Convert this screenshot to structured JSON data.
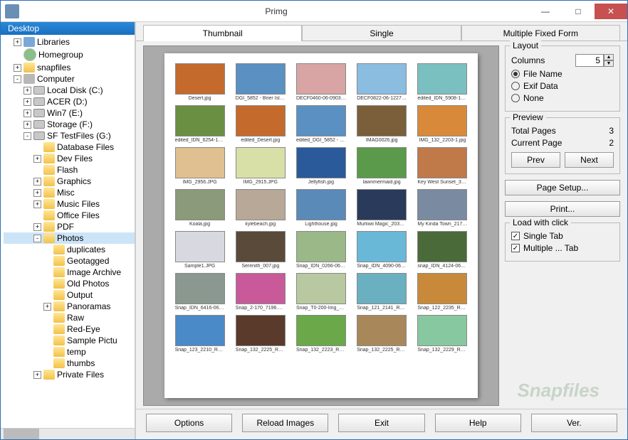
{
  "window": {
    "title": "Primg"
  },
  "tree": {
    "header": "Desktop",
    "nodes": [
      {
        "label": "Libraries",
        "icon": "lib",
        "exp": "+",
        "indent": 1
      },
      {
        "label": "Homegroup",
        "icon": "group",
        "exp": "",
        "indent": 1
      },
      {
        "label": "snapfiles",
        "icon": "folder",
        "exp": "+",
        "indent": 1
      },
      {
        "label": "Computer",
        "icon": "comp",
        "exp": "-",
        "indent": 1
      },
      {
        "label": "Local Disk (C:)",
        "icon": "disk",
        "exp": "+",
        "indent": 2
      },
      {
        "label": "ACER (D:)",
        "icon": "disk",
        "exp": "+",
        "indent": 2
      },
      {
        "label": "Win7 (E:)",
        "icon": "disk",
        "exp": "+",
        "indent": 2
      },
      {
        "label": "Storage (F:)",
        "icon": "disk",
        "exp": "+",
        "indent": 2
      },
      {
        "label": "SF TestFiles (G:)",
        "icon": "disk",
        "exp": "-",
        "indent": 2
      },
      {
        "label": "Database Files",
        "icon": "folder",
        "exp": "",
        "indent": 3
      },
      {
        "label": "Dev Files",
        "icon": "folder",
        "exp": "+",
        "indent": 3
      },
      {
        "label": "Flash",
        "icon": "folder",
        "exp": "",
        "indent": 3
      },
      {
        "label": "Graphics",
        "icon": "folder",
        "exp": "+",
        "indent": 3
      },
      {
        "label": "Misc",
        "icon": "folder",
        "exp": "+",
        "indent": 3
      },
      {
        "label": "Music Files",
        "icon": "folder",
        "exp": "+",
        "indent": 3
      },
      {
        "label": "Office Files",
        "icon": "folder",
        "exp": "",
        "indent": 3
      },
      {
        "label": "PDF",
        "icon": "folder",
        "exp": "+",
        "indent": 3
      },
      {
        "label": "Photos",
        "icon": "folder",
        "exp": "-",
        "indent": 3,
        "selected": true
      },
      {
        "label": "duplicates",
        "icon": "folder",
        "exp": "",
        "indent": 4
      },
      {
        "label": "Geotagged",
        "icon": "folder",
        "exp": "",
        "indent": 4
      },
      {
        "label": "Image Archive",
        "icon": "folder",
        "exp": "",
        "indent": 4
      },
      {
        "label": "Old Photos",
        "icon": "folder",
        "exp": "",
        "indent": 4
      },
      {
        "label": "Output",
        "icon": "folder",
        "exp": "",
        "indent": 4
      },
      {
        "label": "Panoramas",
        "icon": "folder",
        "exp": "+",
        "indent": 4
      },
      {
        "label": "Raw",
        "icon": "folder",
        "exp": "",
        "indent": 4
      },
      {
        "label": "Red-Eye",
        "icon": "folder",
        "exp": "",
        "indent": 4
      },
      {
        "label": "Sample Pictu",
        "icon": "folder",
        "exp": "",
        "indent": 4
      },
      {
        "label": "temp",
        "icon": "folder",
        "exp": "",
        "indent": 4
      },
      {
        "label": "thumbs",
        "icon": "folder",
        "exp": "",
        "indent": 4
      },
      {
        "label": "Private Files",
        "icon": "folder",
        "exp": "+",
        "indent": 3
      }
    ]
  },
  "tabs": [
    "Thumbnail",
    "Single",
    "Multiple Fixed Form"
  ],
  "active_tab": 0,
  "thumbnails": [
    {
      "name": "Desert.jpg",
      "c": "#c46a2d"
    },
    {
      "name": "DGI_5852 - Brier Island …",
      "c": "#5a90c2"
    },
    {
      "name": "DECF0460-06-0903.JPG",
      "c": "#d8a4a4"
    },
    {
      "name": "DECF0822-06-1227.JPG",
      "c": "#8bbde0"
    },
    {
      "name": "edited_IDN_5908-12-08…",
      "c": "#7bc0c0"
    },
    {
      "name": "edited_IDN_6254-12-09…",
      "c": "#6a8f42"
    },
    {
      "name": "edited_Desert.jpg",
      "c": "#c46a2d"
    },
    {
      "name": "edited_DGI_5852 - Brier…",
      "c": "#5a90c2"
    },
    {
      "name": "IMAG0026.jpg",
      "c": "#7a5f3a"
    },
    {
      "name": "IMG_132_2203-1.jpg",
      "c": "#d88a3a"
    },
    {
      "name": "IMG_2956.JPG",
      "c": "#e0c090"
    },
    {
      "name": "IMG_2915.JPG",
      "c": "#d8e0a8"
    },
    {
      "name": "Jellyfish.jpg",
      "c": "#2a5a9a"
    },
    {
      "name": "lawnmermaid.jpg",
      "c": "#5a9a4a"
    },
    {
      "name": "Key West Sunset_36442…",
      "c": "#c07a4a"
    },
    {
      "name": "Koala.jpg",
      "c": "#8a9a7a"
    },
    {
      "name": "kylebeach.jpg",
      "c": "#b8a898"
    },
    {
      "name": "Lighthouse.jpg",
      "c": "#5a8ab8"
    },
    {
      "name": "Murkwii Magic_2039285…",
      "c": "#2a3a5a"
    },
    {
      "name": "My Kinda Town_217440…",
      "c": "#7a8aa0"
    },
    {
      "name": "Sample1.JPG",
      "c": "#d8d8e0"
    },
    {
      "name": "Serenith_007.jpg",
      "c": "#5a4a3a"
    },
    {
      "name": "Snap_IDN_0266-06-04…",
      "c": "#9ab888"
    },
    {
      "name": "Snap_IDN_4090-06-062…",
      "c": "#6ab8d8"
    },
    {
      "name": "snap_IDN_4124-06-062…",
      "c": "#4a6a3a"
    },
    {
      "name": "Snap_IDN_6416-06-07…",
      "c": "#8a9890"
    },
    {
      "name": "Snap_2-170_7196.JPG",
      "c": "#c85a9a"
    },
    {
      "name": "Snap_T0-200-Img_4291…",
      "c": "#b8c8a0"
    },
    {
      "name": "Snap_121_2141_R2.JPG",
      "c": "#6ab0c0"
    },
    {
      "name": "Snap_122_2235_R2.JPG",
      "c": "#c88a3a"
    },
    {
      "name": "Snap_123_2210_R2.JPG",
      "c": "#4a8ac8"
    },
    {
      "name": "Snap_132_2225_R2.JPG",
      "c": "#5a3a2a"
    },
    {
      "name": "Snap_132_2223_R2 (Sh…",
      "c": "#6aa84a"
    },
    {
      "name": "Snap_132_2225_R2.JPG",
      "c": "#a8885a"
    },
    {
      "name": "Snap_132_2229_R2crop…",
      "c": "#88c8a0"
    }
  ],
  "layout": {
    "legend": "Layout",
    "columns_label": "Columns",
    "columns_value": "5",
    "radios": [
      "File Name",
      "Exif Data",
      "None"
    ],
    "radio_selected": 0
  },
  "preview": {
    "legend": "Preview",
    "total_label": "Total Pages",
    "total_value": "3",
    "current_label": "Current Page",
    "current_value": "2",
    "prev": "Prev",
    "next": "Next"
  },
  "page_setup": "Page Setup...",
  "print": "Print...",
  "load_click": {
    "legend": "Load with click",
    "checks": [
      "Single Tab",
      "Multiple ... Tab"
    ]
  },
  "bottom": [
    "Options",
    "Reload Images",
    "Exit",
    "Help",
    "Ver."
  ],
  "watermark": "Snapfiles"
}
